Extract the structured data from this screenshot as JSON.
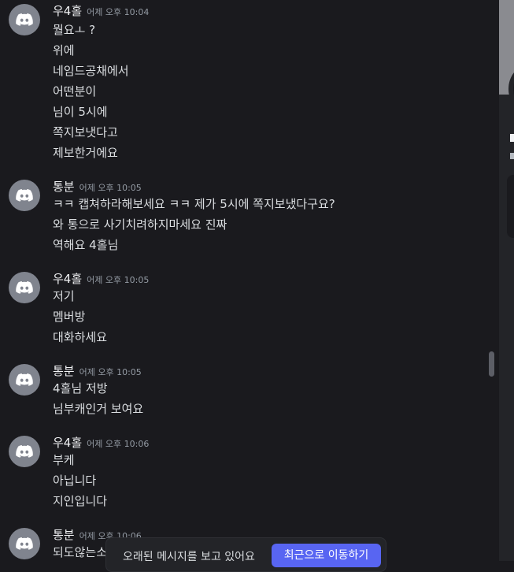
{
  "avatar_icon": "discord-logo-icon",
  "colors": {
    "accent": "#5865f2",
    "avatar_bg": "#80848e",
    "background": "#1a1a1e"
  },
  "messages": [
    {
      "author": "우4홀",
      "timestamp": "어제 오후 10:04",
      "lines": [
        "뭘요ㅗ ?",
        "위에",
        "네임드공채에서",
        "어떤분이",
        "님이 5시에",
        "쪽지보냇다고",
        "제보한거에요"
      ]
    },
    {
      "author": "통분",
      "timestamp": "어제 오후 10:05",
      "lines": [
        "ㅋㅋ 캡쳐하라해보세요 ㅋㅋ 제가 5시에 쪽지보냈다구요?",
        "와 통으로 사기치려하지마세요 진짜",
        "역해요 4홀님"
      ]
    },
    {
      "author": "우4홀",
      "timestamp": "어제 오후 10:05",
      "lines": [
        "저기",
        "멤버방",
        "대화하세요"
      ]
    },
    {
      "author": "통분",
      "timestamp": "어제 오후 10:05",
      "lines": [
        "4홀님 저방",
        "님부캐인거 보여요"
      ]
    },
    {
      "author": "우4홀",
      "timestamp": "어제 오후 10:06",
      "lines": [
        "부케",
        "아닙니다",
        "지인입니다"
      ]
    },
    {
      "author": "통분",
      "timestamp": "어제 오후 10:06",
      "lines": [
        "되도않는소"
      ]
    }
  ],
  "jump_bar": {
    "text": "오래된 메시지를 보고 있어요",
    "button_label": "최근으로 이동하기"
  }
}
